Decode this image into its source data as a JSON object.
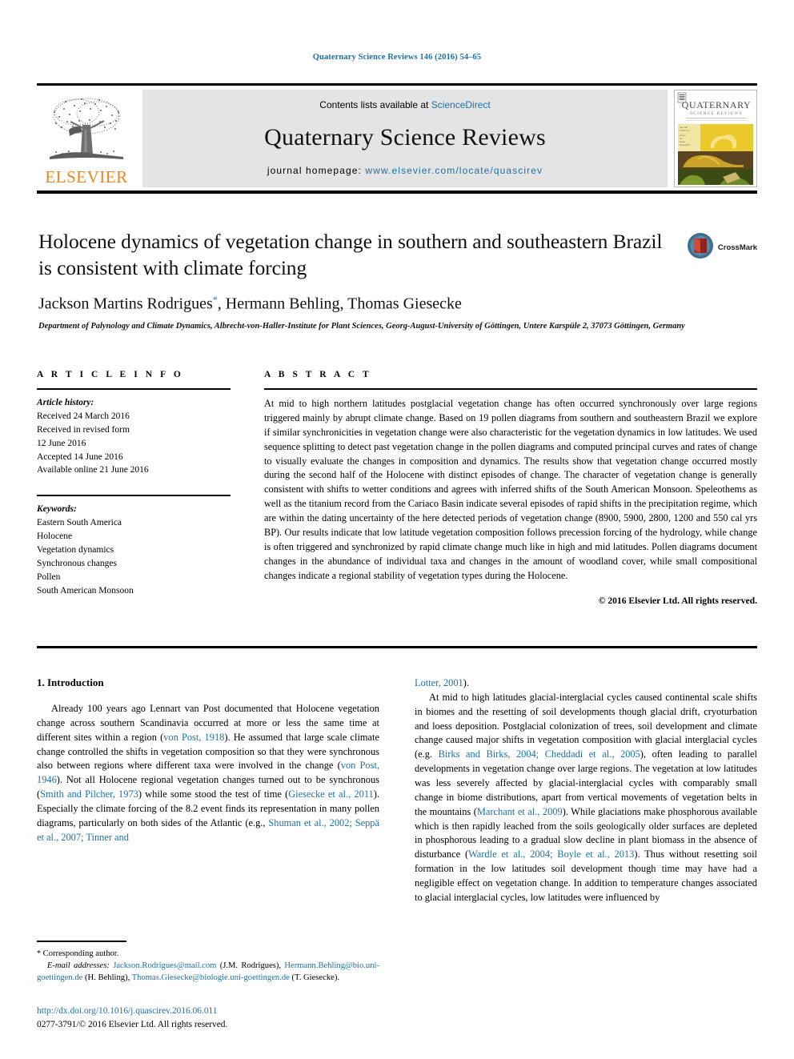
{
  "running_head": "Quaternary Science Reviews 146 (2016) 54–65",
  "masthead": {
    "publisher": "ELSEVIER",
    "contents_prefix": "Contents lists available at ",
    "contents_link": "ScienceDirect",
    "journal_title": "Quaternary Science Reviews",
    "homepage_prefix": "journal homepage: ",
    "homepage_url": "www.elsevier.com/locate/quascirev",
    "cover_journal_name": "QUATERNARY",
    "cover_journal_sub": "SCIENCE REVIEWS"
  },
  "article": {
    "title": "Holocene dynamics of vegetation change in southern and southeastern Brazil is consistent with climate forcing",
    "authors": "Jackson Martins Rodrigues, Hermann Behling, Thomas Giesecke",
    "corresponding_marker": "*",
    "affiliation": "Department of Palynology and Climate Dynamics, Albrecht-von-Haller-Institute for Plant Sciences, Georg-August-University of Göttingen, Untere Karspüle 2, 37073 Göttingen, Germany",
    "crossmark_label": "CrossMark"
  },
  "article_info": {
    "heading": "A R T I C L E  I N F O",
    "history_label": "Article history:",
    "history": [
      "Received 24 March 2016",
      "Received in revised form",
      "12 June 2016",
      "Accepted 14 June 2016",
      "Available online 21 June 2016"
    ],
    "keywords_label": "Keywords:",
    "keywords": [
      "Eastern South America",
      "Holocene",
      "Vegetation dynamics",
      "Synchronous changes",
      "Pollen",
      "South American Monsoon"
    ]
  },
  "abstract": {
    "heading": "A B S T R A C T",
    "text": "At mid to high northern latitudes postglacial vegetation change has often occurred synchronously over large regions triggered mainly by abrupt climate change. Based on 19 pollen diagrams from southern and southeastern Brazil we explore if similar synchronicities in vegetation change were also characteristic for the vegetation dynamics in low latitudes. We used sequence splitting to detect past vegetation change in the pollen diagrams and computed principal curves and rates of change to visually evaluate the changes in composition and dynamics. The results show that vegetation change occurred mostly during the second half of the Holocene with distinct episodes of change. The character of vegetation change is generally consistent with shifts to wetter conditions and agrees with inferred shifts of the South American Monsoon. Speleothems as well as the titanium record from the Cariaco Basin indicate several episodes of rapid shifts in the precipitation regime, which are within the dating uncertainty of the here detected periods of vegetation change (8900, 5900, 2800, 1200 and 550 cal yrs BP). Our results indicate that low latitude vegetation composition follows precession forcing of the hydrology, while change is often triggered and synchronized by rapid climate change much like in high and mid latitudes. Pollen diagrams document changes in the abundance of individual taxa and changes in the amount of woodland cover, while small compositional changes indicate a regional stability of vegetation types during the Holocene.",
    "copyright": "© 2016 Elsevier Ltd. All rights reserved."
  },
  "body": {
    "section_heading": "1. Introduction",
    "left_paragraph_1_a": "Already 100 years ago Lennart van Post documented that Holocene vegetation change across southern Scandinavia occurred at more or less the same time at different sites within a region (",
    "ref_von_post_1918": "von Post, 1918",
    "left_paragraph_1_b": "). He assumed that large scale climate change controlled the shifts in vegetation composition so that they were synchronous also between regions where different taxa were involved in the change (",
    "ref_von_post_1946": "von Post, 1946",
    "left_paragraph_1_c": "). Not all Holocene regional vegetation changes turned out to be synchronous (",
    "ref_smith_pilcher": "Smith and Pilcher, 1973",
    "left_paragraph_1_d": ") while some stood the test of time (",
    "ref_giesecke_2011": "Giesecke et al., 2011",
    "left_paragraph_1_e": "). Especially the climate forcing of the 8.2 event finds its representation in many pollen diagrams, particularly on both sides of the Atlantic (e.g., ",
    "ref_shuman_seppa_tinner": "Shuman et al., 2002; Seppä et al., 2007; Tinner and",
    "right_continuation_ref": "Lotter, 2001",
    "right_continuation_tail": ").",
    "right_paragraph_a": "At mid to high latitudes glacial-interglacial cycles caused continental scale shifts in biomes and the resetting of soil developments though glacial drift, cryoturbation and loess deposition. Postglacial colonization of trees, soil development and climate change caused major shifts in vegetation composition with glacial interglacial cycles (e.g. ",
    "ref_birks_cheddadi": "Birks and Birks, 2004; Cheddadi et al., 2005",
    "right_paragraph_b": "), often leading to parallel developments in vegetation change over large regions. The vegetation at low latitudes was less severely affected by glacial-interglacial cycles with comparably small change in biome distributions, apart from vertical movements of vegetation belts in the mountains (",
    "ref_marchant": "Marchant et al., 2009",
    "right_paragraph_c": "). While glaciations make phosphorous available which is then rapidly leached from the soils geologically older surfaces are depleted in phosphorous leading to a gradual slow decline in plant biomass in the absence of disturbance (",
    "ref_wardle_boyle": "Wardle et al., 2004; Boyle et al., 2013",
    "right_paragraph_d": "). Thus without resetting soil formation in the low latitudes soil development though time may have had a negligible effect on vegetation change. In addition to temperature changes associated to glacial interglacial cycles, low latitudes were influenced by"
  },
  "footnote": {
    "star": "*",
    "corresponding": " Corresponding author.",
    "email_label": "E-mail addresses:",
    "email_1": "Jackson.Rodrigues@mail.com",
    "email_1_who": " (J.M. Rodrigues), ",
    "email_2": "Hermann.Behling@bio.uni-goettingen.de",
    "email_2_who": " (H. Behling), ",
    "email_3": "Thomas.Giesecke@biologie.uni-goettingen.de",
    "email_3_who": " (T. Giesecke)."
  },
  "doi_block": {
    "doi_url": "http://dx.doi.org/10.1016/j.quascirev.2016.06.011",
    "issn_line": "0277-3791/© 2016 Elsevier Ltd. All rights reserved."
  },
  "colors": {
    "link_blue": "#1a72a8",
    "elsevier_orange": "#F08520",
    "panel_grey": "#e4e4e4",
    "crossmark_red": "#B4312E",
    "crossmark_blue": "#3E6E8E"
  }
}
